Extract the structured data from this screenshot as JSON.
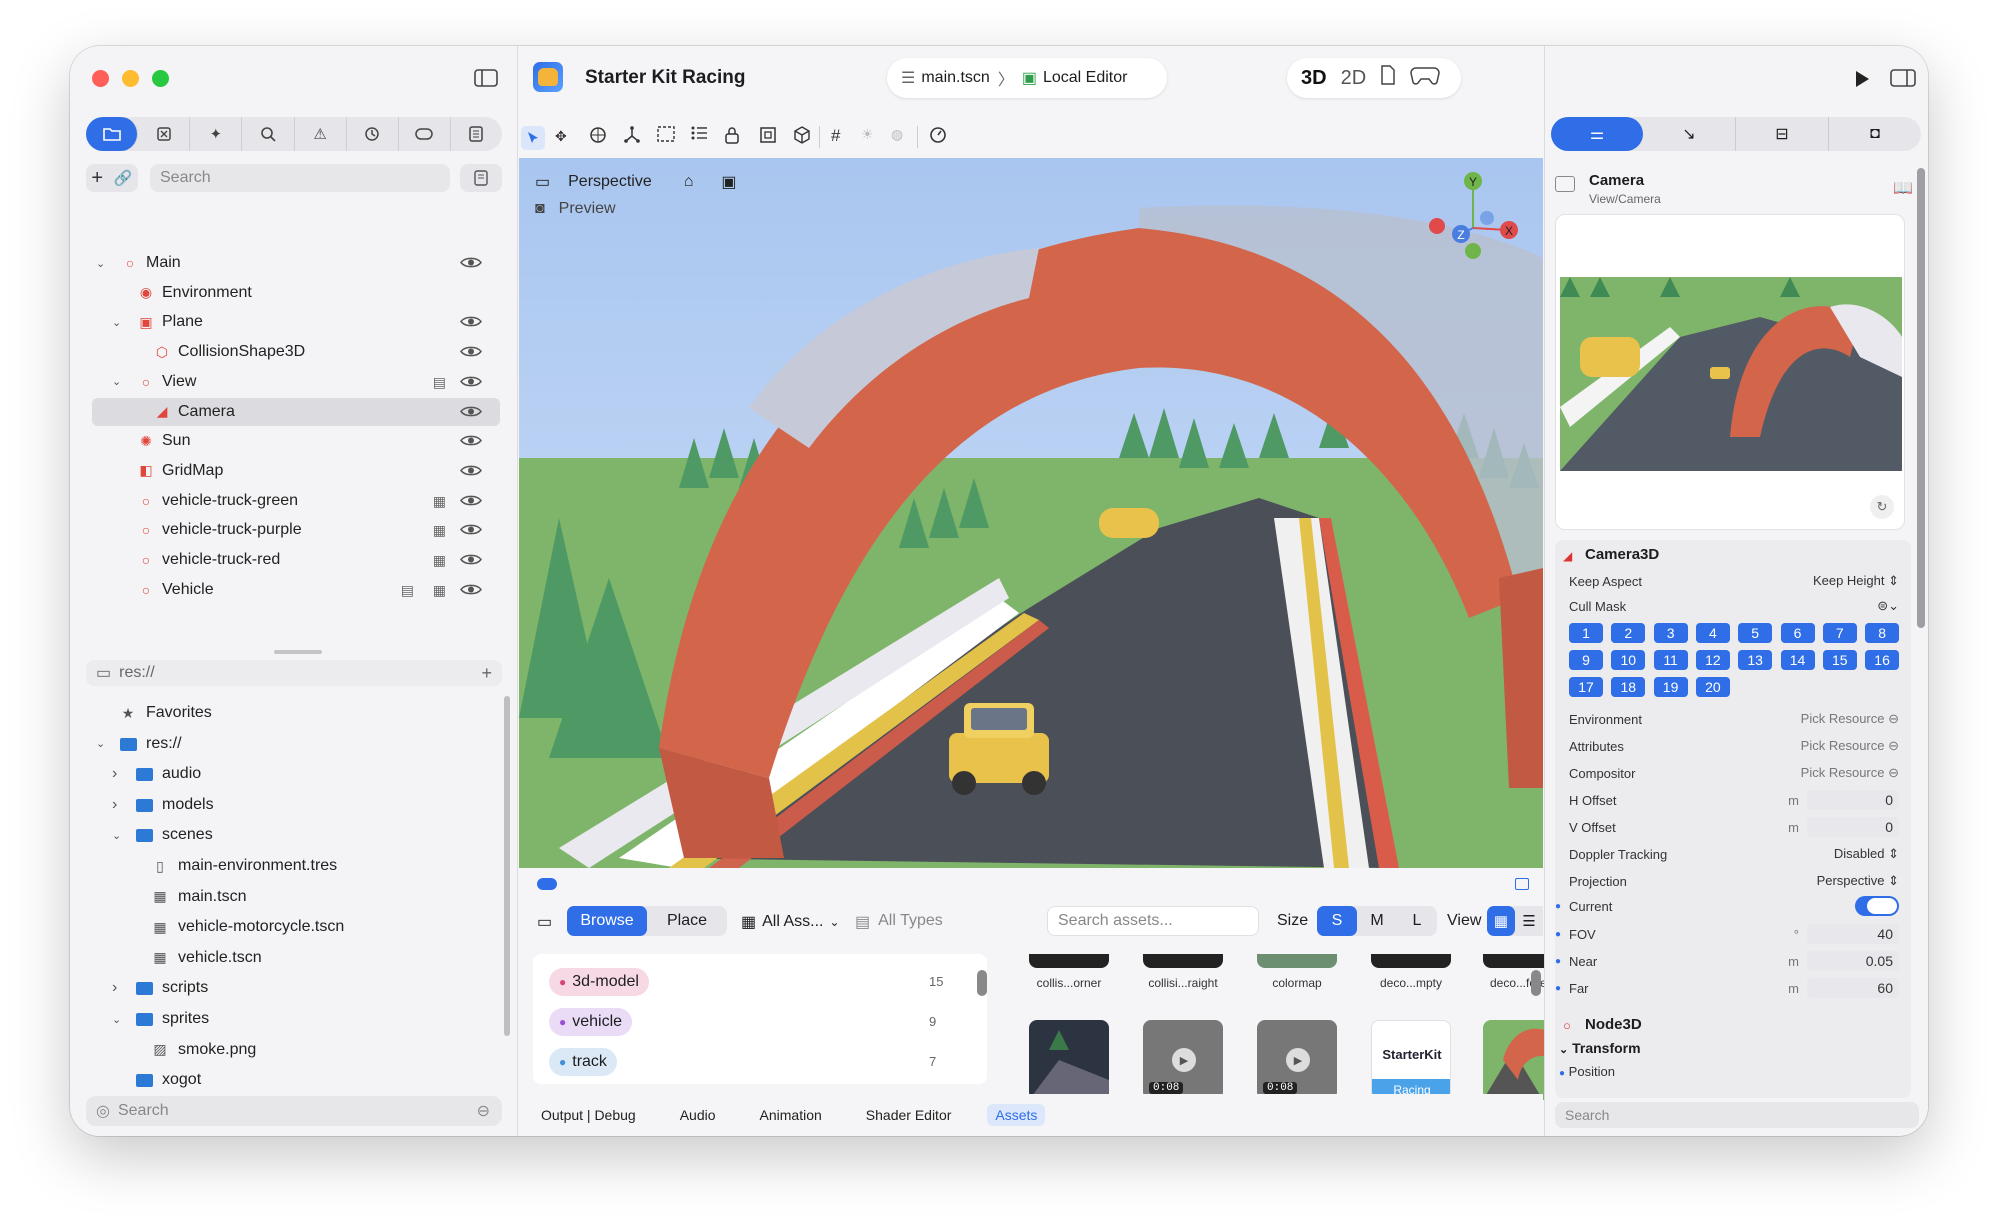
{
  "app": {
    "project_name": "Starter Kit Racing"
  },
  "breadcrumb": {
    "scene": "main.tscn",
    "separator": "〉",
    "editor": "Local Editor"
  },
  "mode_switch": {
    "three_d": "3D",
    "two_d": "2D"
  },
  "left_tabs": [
    "files-icon",
    "scene-icon",
    "magic-icon",
    "search-icon",
    "warning-icon",
    "history-icon",
    "tag-icon",
    "document-icon"
  ],
  "scene_tree": {
    "search_placeholder": "Search",
    "nodes": [
      {
        "label": "Main",
        "depth": 0,
        "chevron": "⌄",
        "icon_color": "#e0463c"
      },
      {
        "label": "Environment",
        "depth": 1,
        "chevron": "",
        "icon_color": "#e0463c"
      },
      {
        "label": "Plane",
        "depth": 1,
        "chevron": "⌄",
        "icon_color": "#e0463c"
      },
      {
        "label": "CollisionShape3D",
        "depth": 2,
        "chevron": "",
        "icon_color": "#e0463c"
      },
      {
        "label": "View",
        "depth": 1,
        "chevron": "⌄",
        "icon_color": "#e0463c"
      },
      {
        "label": "Camera",
        "depth": 2,
        "chevron": "",
        "icon_color": "#e0463c"
      },
      {
        "label": "Sun",
        "depth": 1,
        "chevron": "",
        "icon_color": "#e0463c"
      },
      {
        "label": "GridMap",
        "depth": 1,
        "chevron": "",
        "icon_color": "#e0463c"
      },
      {
        "label": "vehicle-truck-green",
        "depth": 1,
        "chevron": "",
        "icon_color": "#e0463c"
      },
      {
        "label": "vehicle-truck-purple",
        "depth": 1,
        "chevron": "",
        "icon_color": "#e0463c"
      },
      {
        "label": "vehicle-truck-red",
        "depth": 1,
        "chevron": "",
        "icon_color": "#e0463c"
      },
      {
        "label": "Vehicle",
        "depth": 1,
        "chevron": "",
        "icon_color": "#e0463c"
      }
    ]
  },
  "filesystem": {
    "path": "res://",
    "search_placeholder": "Search",
    "items": [
      {
        "label": "Favorites",
        "type": "star",
        "depth": 0,
        "chevron": ""
      },
      {
        "label": "res://",
        "type": "folder",
        "depth": 0,
        "chevron": "⌄"
      },
      {
        "label": "audio",
        "type": "folder",
        "depth": 1,
        "chevron": "›"
      },
      {
        "label": "models",
        "type": "folder",
        "depth": 1,
        "chevron": "›"
      },
      {
        "label": "scenes",
        "type": "folder",
        "depth": 1,
        "chevron": "⌄"
      },
      {
        "label": "main-environment.tres",
        "type": "file",
        "depth": 2,
        "chevron": ""
      },
      {
        "label": "main.tscn",
        "type": "scene",
        "depth": 2,
        "chevron": ""
      },
      {
        "label": "vehicle-motorcycle.tscn",
        "type": "scene",
        "depth": 2,
        "chevron": ""
      },
      {
        "label": "vehicle.tscn",
        "type": "scene",
        "depth": 2,
        "chevron": ""
      },
      {
        "label": "scripts",
        "type": "folder",
        "depth": 1,
        "chevron": "›"
      },
      {
        "label": "sprites",
        "type": "folder",
        "depth": 1,
        "chevron": "⌄"
      },
      {
        "label": "smoke.png",
        "type": "image",
        "depth": 2,
        "chevron": ""
      },
      {
        "label": "xogot",
        "type": "folder",
        "depth": 1,
        "chevron": ""
      }
    ]
  },
  "viewport": {
    "perspective": "Perspective",
    "preview": "Preview",
    "gizmo": {
      "y": "Y",
      "z": "Z",
      "x": "X"
    }
  },
  "assets": {
    "browse": "Browse",
    "place": "Place",
    "filter": "All Ass...",
    "types": "All Types",
    "search_placeholder": "Search assets...",
    "size_label": "Size",
    "sizes": [
      "S",
      "M",
      "L"
    ],
    "view_label": "View",
    "tags": [
      {
        "label": "3d-model",
        "count": "15",
        "color": "#d6457a",
        "bg": "#f6d9e5"
      },
      {
        "label": "vehicle",
        "count": "9",
        "color": "#9b4ed6",
        "bg": "#eadcf7"
      },
      {
        "label": "track",
        "count": "7",
        "color": "#3f8fd8",
        "bg": "#dbe9f7"
      }
    ],
    "row1_labels": [
      "collis...orner",
      "collisi...raight",
      "colormap",
      "deco...mpty",
      "deco...forest"
    ],
    "video_duration": "0:08",
    "logo_text_1": "StarterKit",
    "logo_text_2": "Racing"
  },
  "bottom_tabs": [
    "Output | Debug",
    "Audio",
    "Animation",
    "Shader Editor",
    "Assets"
  ],
  "inspector": {
    "node_name": "Camera",
    "node_path": "View/Camera",
    "class_name": "Camera3D",
    "keep_aspect_label": "Keep Aspect",
    "keep_aspect_value": "Keep Height ⇕",
    "cull_mask_label": "Cull Mask",
    "cull_layers": [
      "1",
      "2",
      "3",
      "4",
      "5",
      "6",
      "7",
      "8",
      "9",
      "10",
      "11",
      "12",
      "13",
      "14",
      "15",
      "16",
      "17",
      "18",
      "19",
      "20"
    ],
    "environment_label": "Environment",
    "environment_value": "Pick Resource",
    "attributes_label": "Attributes",
    "attributes_value": "Pick Resource",
    "compositor_label": "Compositor",
    "compositor_value": "Pick Resource",
    "h_offset_label": "H Offset",
    "h_offset_unit": "m",
    "h_offset_value": "0",
    "v_offset_label": "V Offset",
    "v_offset_unit": "m",
    "v_offset_value": "0",
    "doppler_label": "Doppler Tracking",
    "doppler_value": "Disabled ⇕",
    "projection_label": "Projection",
    "projection_value": "Perspective ⇕",
    "current_label": "Current",
    "fov_label": "FOV",
    "fov_unit": "°",
    "fov_value": "40",
    "near_label": "Near",
    "near_unit": "m",
    "near_value": "0.05",
    "far_label": "Far",
    "far_unit": "m",
    "far_value": "60",
    "node3d_label": "Node3D",
    "transform_label": "Transform",
    "position_label": "Position",
    "search_placeholder": "Search"
  }
}
